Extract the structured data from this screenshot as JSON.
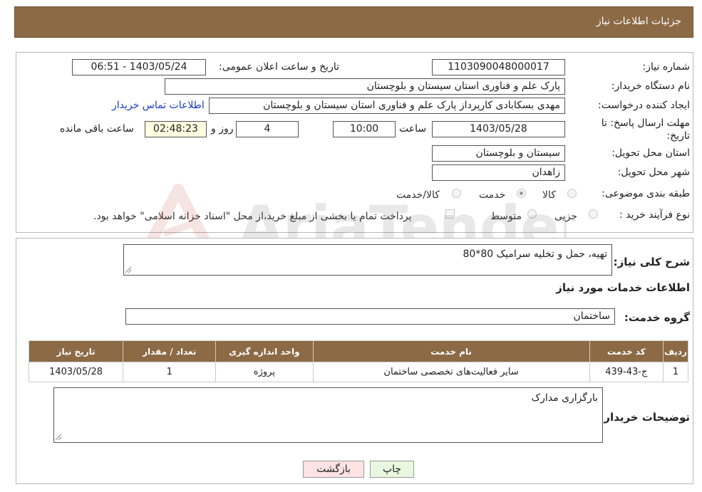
{
  "header": {
    "title": "جزئیات اطلاعات نیاز"
  },
  "fields": {
    "need_number_label": "شماره نیاز:",
    "need_number": "1103090048000017",
    "announce_label": "تاریخ و ساعت اعلان عمومی:",
    "announce_value": "1403/05/24 - 06:51",
    "buyer_org_label": "نام دستگاه خریدار:",
    "buyer_org": "پارک علم و فناوری استان سیستان و بلوچستان",
    "creator_label": "ایجاد کننده درخواست:",
    "creator": "مهدی بسکابادی کارپرداز پارک علم و فناوری استان سیستان و بلوچستان",
    "contact_link": "اطلاعات تماس خریدار",
    "deadline_label_1": "مهلت ارسال پاسخ: تا",
    "deadline_label_2": "تاریخ:",
    "deadline_date": "1403/05/28",
    "time_label": "ساعت",
    "deadline_time": "10:00",
    "days": "4",
    "days_label": "روز و",
    "remaining": "02:48:23",
    "remaining_label": "ساعت باقی مانده",
    "province_label": "استان محل تحویل:",
    "province": "سیستان و بلوچستان",
    "city_label": "شهر محل تحویل:",
    "city": "زاهدان",
    "category_label": "طبقه بندی موضوعی:",
    "category_options": [
      "کالا",
      "خدمت",
      "کالا/خدمت"
    ],
    "category_selected": "خدمت",
    "process_label": "نوع فرآیند خرید :",
    "process_options": [
      "جزیی",
      "متوسط"
    ],
    "payment_note": "پرداخت تمام یا بخشی از مبلغ خرید،از محل \"اسناد خزانه اسلامی\" خواهد بود."
  },
  "details": {
    "summary_label": "شرح کلی نیاز:",
    "summary": "تهیه، حمل و تخلیه سرامیک 80*80",
    "services_title": "اطلاعات خدمات مورد نیاز",
    "group_label": "گروه خدمت:",
    "group": "ساختمان",
    "table": {
      "headers": [
        "ردیف",
        "کد خدمت",
        "نام خدمت",
        "واحد اندازه گیری",
        "تعداد / مقدار",
        "تاریخ نیاز"
      ],
      "rows": [
        [
          "1",
          "ج-43-439",
          "سایر فعالیت‌های تخصصی ساختمان",
          "پروژه",
          "1",
          "1403/05/28"
        ]
      ]
    },
    "buyer_notes_label": "توضیحات خریدار:",
    "buyer_notes": "بارگزاری مدارک"
  },
  "buttons": {
    "print": "چاپ",
    "back": "بازگشت"
  },
  "watermark": {
    "text": "AriaTender.net",
    "icon": "aria-logo-icon"
  },
  "colors": {
    "header": "#8b6a45",
    "link": "#1a3ccc",
    "back_button": "#fde3e3",
    "print_button": "#e8f8e0"
  }
}
